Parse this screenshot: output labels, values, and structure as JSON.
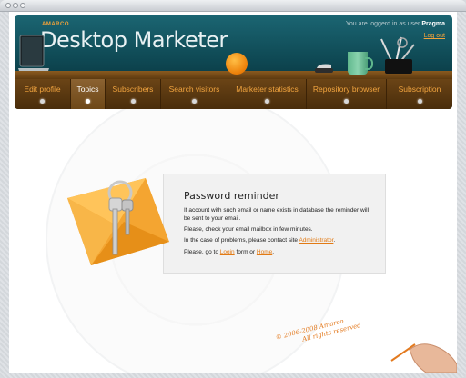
{
  "header": {
    "brand_small": "AMARCO",
    "brand_left": "Desktop",
    "brand_right": "Marketer",
    "user_prefix": "You are loggerd in as user",
    "username": "Pragma",
    "logout": "Log out"
  },
  "nav": {
    "items": [
      {
        "label": "Edit profile"
      },
      {
        "label": "Topics"
      },
      {
        "label": "Subscribers"
      },
      {
        "label": "Search visitors"
      },
      {
        "label": "Marketer statistics"
      },
      {
        "label": "Repository browser"
      },
      {
        "label": "Subscription"
      }
    ],
    "active_index": 1
  },
  "reminder": {
    "title": "Password reminder",
    "p1": "If account with such email or name exists in database the reminder will be sent to your email.",
    "p2": "Please, check your email mailbox in few minutes.",
    "p3_prefix": "In the case of problems, please contact site",
    "p3_link": "Administrator",
    "p3_suffix": ".",
    "p4_prefix": "Please, go to",
    "p4_link1": "Login",
    "p4_mid": "form or",
    "p4_link2": "Home",
    "p4_suffix": "."
  },
  "footer": {
    "line1": "© 2006-2008 Amarco",
    "line2": "All rights reserved"
  },
  "colors": {
    "accent": "#e27a14",
    "header_teal": "#0f4a55",
    "nav_brown": "#5a3810"
  }
}
